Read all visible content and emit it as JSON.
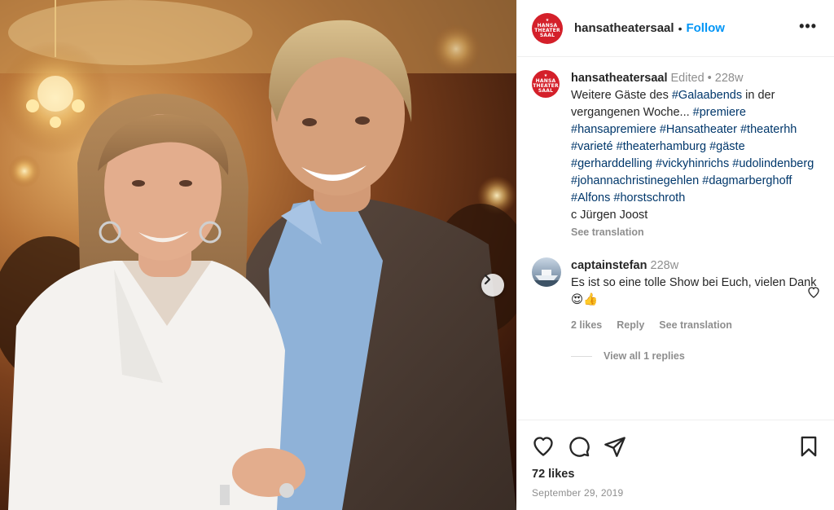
{
  "header": {
    "username": "hansatheatersaal",
    "separator": "•",
    "follow_label": "Follow",
    "more_label": "•••"
  },
  "logo": {
    "lines": [
      "HANSA",
      "THEATER",
      "SAAL"
    ],
    "color": "#d4202a"
  },
  "caption": {
    "username": "hansatheatersaal",
    "edited": "Edited",
    "separator": "•",
    "age": "228w",
    "text_1": "Weitere Gäste des ",
    "tag_1": "#Galaabends",
    "text_2": " in der vergangenen Woche... ",
    "tags": [
      "#premiere",
      "#hansapremiere",
      "#Hansatheater",
      "#theaterhh",
      "#varieté",
      "#theaterhamburg",
      "#gäste",
      "#gerharddelling",
      "#vickyhinrichs",
      "#udolindenberg",
      "#johannachristinegehlen",
      "#dagmarberghoff",
      "#Alfons",
      "#horstschroth"
    ],
    "credit": "c Jürgen Joost",
    "see_translation": "See translation"
  },
  "comment": {
    "username": "captainstefan",
    "age": "228w",
    "text": "Es ist so eine tolle Show bei Euch, vielen Dank 😍👍",
    "likes": "2 likes",
    "reply_label": "Reply",
    "see_translation": "See translation",
    "view_replies": "View all 1 replies"
  },
  "post": {
    "likes": "72 likes",
    "date": "September 29, 2019"
  },
  "icons": {
    "heart": "heart-icon",
    "comment": "comment-icon",
    "share": "share-icon",
    "save": "bookmark-icon",
    "next": "chevron-right-icon"
  },
  "colors": {
    "accent": "#0095f6",
    "hashtag": "#00376b",
    "muted": "#8e8e8e",
    "text": "#262626"
  }
}
